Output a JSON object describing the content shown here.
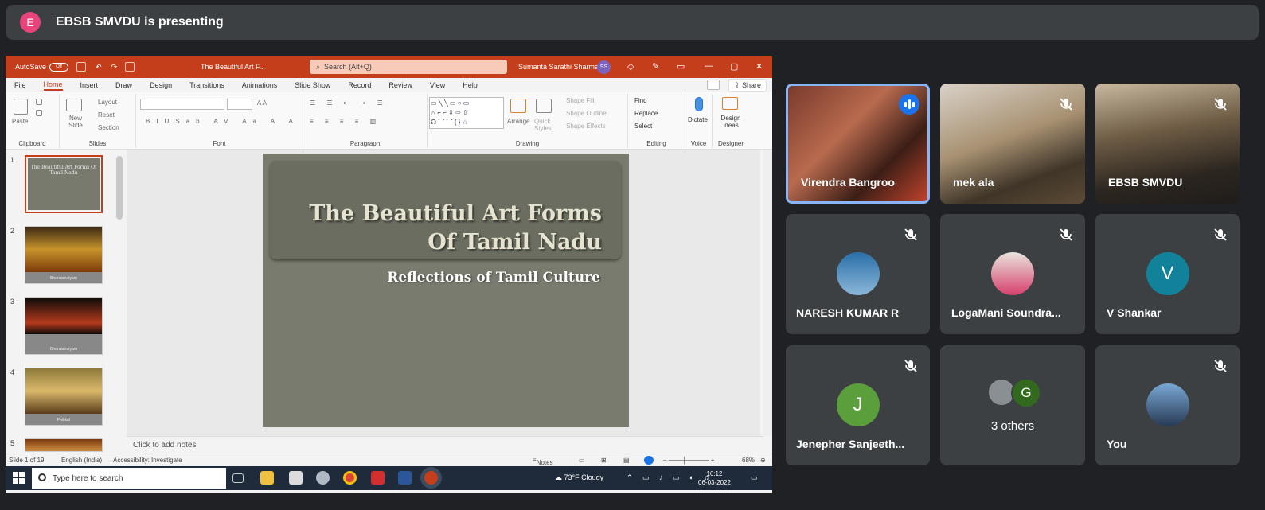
{
  "meet": {
    "presenter_initial": "E",
    "presenting_label": "EBSB SMVDU is presenting",
    "participants": [
      {
        "name": "Virendra Bangroo"
      },
      {
        "name": "mek ala"
      },
      {
        "name": "EBSB SMVDU"
      },
      {
        "name": "NARESH KUMAR R"
      },
      {
        "name": "LogaMani Soundra..."
      },
      {
        "name": "V Shankar",
        "initial": "V"
      },
      {
        "name": "Jenepher Sanjeeth...",
        "initial": "J"
      },
      {
        "name": "3 others",
        "initial": "G"
      },
      {
        "name": "You"
      }
    ]
  },
  "ppt": {
    "autosave_label": "AutoSave",
    "autosave_state": "Off",
    "doc_title": "The Beautiful Art F...",
    "search_placeholder": "Search (Alt+Q)",
    "user_name": "Sumanta Sarathi Sharma",
    "user_initials": "SS",
    "menu": [
      "File",
      "Home",
      "Insert",
      "Draw",
      "Design",
      "Transitions",
      "Animations",
      "Slide Show",
      "Record",
      "Review",
      "View",
      "Help"
    ],
    "share_label": "Share",
    "ribbon": {
      "clipboard": {
        "label": "Clipboard",
        "paste": "Paste"
      },
      "slides": {
        "label": "Slides",
        "new_slide": "New Slide",
        "layout": "Layout",
        "reset": "Reset",
        "section": "Section"
      },
      "font": {
        "label": "Font"
      },
      "paragraph": {
        "label": "Paragraph"
      },
      "drawing": {
        "label": "Drawing",
        "arrange": "Arrange",
        "quick_styles": "Quick Styles",
        "shape_fill": "Shape Fill",
        "shape_outline": "Shape Outline",
        "shape_effects": "Shape Effects"
      },
      "editing": {
        "label": "Editing",
        "find": "Find",
        "replace": "Replace",
        "select": "Select"
      },
      "voice": {
        "label": "Voice",
        "dictate": "Dictate"
      },
      "designer": {
        "label": "Designer",
        "design_ideas": "Design Ideas"
      }
    },
    "thumbnails": [
      {
        "num": "1",
        "caption": "The Beautiful Art Forms Of Tamil Nadu"
      },
      {
        "num": "2",
        "caption": "Bharatanatyam"
      },
      {
        "num": "3",
        "caption": "Bharatanatyam"
      },
      {
        "num": "4",
        "caption": "Poikkal"
      },
      {
        "num": "5",
        "caption": ""
      }
    ],
    "slide": {
      "title_line1": "The Beautiful Art Forms",
      "title_line2": "Of Tamil Nadu",
      "subtitle": "Reflections of Tamil Culture"
    },
    "notes_placeholder": "Click to add notes",
    "status": {
      "slide_count": "Slide 1 of 19",
      "language": "English (India)",
      "accessibility": "Accessibility: Investigate",
      "notes": "Notes",
      "zoom": "68%"
    }
  },
  "taskbar": {
    "search_placeholder": "Type here to search",
    "weather": "73°F  Cloudy",
    "time": "16:12",
    "date": "06-03-2022"
  }
}
